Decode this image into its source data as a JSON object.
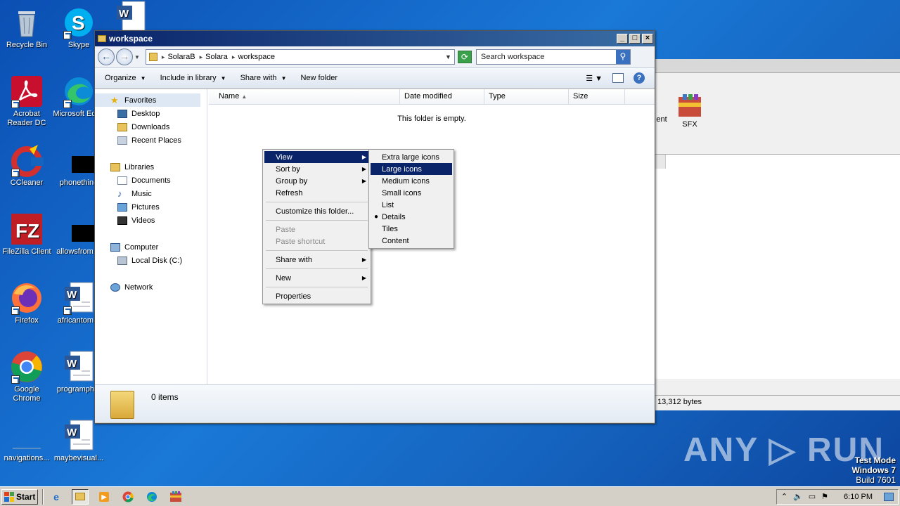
{
  "desktop": {
    "icons": [
      {
        "label": "Recycle Bin"
      },
      {
        "label": "Skype"
      },
      {
        "label": "Acrobat Reader DC"
      },
      {
        "label": "Microsoft Edge"
      },
      {
        "label": "CCleaner"
      },
      {
        "label": "phonething"
      },
      {
        "label": "FileZilla Client"
      },
      {
        "label": "allowsfrom.sl"
      },
      {
        "label": "Firefox"
      },
      {
        "label": "africantom..."
      },
      {
        "label": "Google Chrome"
      },
      {
        "label": "programph..."
      },
      {
        "label": "navigations..."
      },
      {
        "label": "maybevisual..."
      }
    ],
    "watermark": "ANY ▷ RUN",
    "test_mode": {
      "line1": "Test Mode",
      "line2": "Windows 7",
      "line3": "Build 7601"
    }
  },
  "background_window": {
    "toolbar_items": [
      "ent",
      "SFX"
    ],
    "status": "13,312 bytes"
  },
  "explorer": {
    "title": "workspace",
    "breadcrumb": [
      "SolaraB",
      "Solara",
      "workspace"
    ],
    "search_placeholder": "Search workspace",
    "commands": {
      "organize": "Organize",
      "include": "Include in library",
      "share": "Share with",
      "new_folder": "New folder"
    },
    "nav": {
      "favorites": "Favorites",
      "favorites_items": [
        "Desktop",
        "Downloads",
        "Recent Places"
      ],
      "libraries": "Libraries",
      "libraries_items": [
        "Documents",
        "Music",
        "Pictures",
        "Videos"
      ],
      "computer": "Computer",
      "computer_items": [
        "Local Disk (C:)"
      ],
      "network": "Network"
    },
    "columns": {
      "name": "Name",
      "date": "Date modified",
      "type": "Type",
      "size": "Size"
    },
    "empty_message": "This folder is empty.",
    "item_count": "0 items"
  },
  "context_menu": {
    "items": {
      "view": "View",
      "sort_by": "Sort by",
      "group_by": "Group by",
      "refresh": "Refresh",
      "customize": "Customize this folder...",
      "paste": "Paste",
      "paste_shortcut": "Paste shortcut",
      "share_with": "Share with",
      "new": "New",
      "properties": "Properties"
    }
  },
  "view_submenu": {
    "items": [
      "Extra large icons",
      "Large icons",
      "Medium icons",
      "Small icons",
      "List",
      "Details",
      "Tiles",
      "Content"
    ],
    "highlighted": "Large icons",
    "selected": "Details"
  },
  "taskbar": {
    "start_label": "Start",
    "clock": "6:10 PM"
  },
  "colors": {
    "desktop": "#1565c0",
    "menu_highlight": "#0a246a",
    "titlebar": "#0a246a"
  }
}
